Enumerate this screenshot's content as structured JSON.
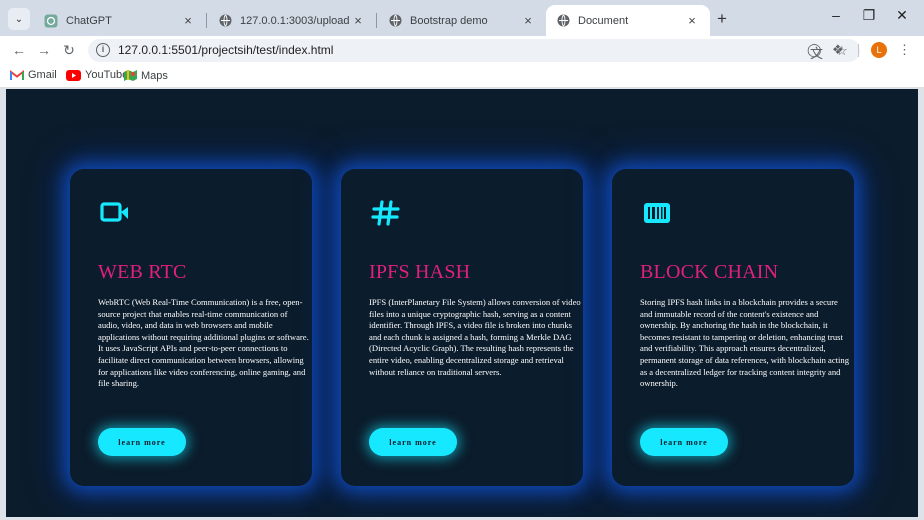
{
  "browser": {
    "tabs": [
      {
        "title": "ChatGPT",
        "active": false,
        "favicon": "chatgpt-icon"
      },
      {
        "title": "127.0.0.1:3003/upload",
        "active": false,
        "favicon": "globe-icon"
      },
      {
        "title": "Bootstrap demo",
        "active": false,
        "favicon": "globe-icon"
      },
      {
        "title": "Document",
        "active": true,
        "favicon": "globe-icon"
      }
    ],
    "new_tab_label": "+",
    "url": "127.0.0.1:5501/projectsih/test/index.html",
    "profile_initial": "L",
    "bookmarks": [
      {
        "label": "Gmail",
        "icon": "gmail-icon"
      },
      {
        "label": "YouTube",
        "icon": "youtube-icon"
      },
      {
        "label": "Maps",
        "icon": "maps-icon"
      }
    ]
  },
  "cards": [
    {
      "icon": "video-camera-icon",
      "title": "WEB RTC",
      "text": "WebRTC (Web Real-Time Communication) is a free, open-source project that enables real-time communication of audio, video, and data in web browsers and mobile applications without requiring additional plugins or software. It uses JavaScript APIs and peer-to-peer connections to facilitate direct communication between browsers, allowing for applications like video conferencing, online gaming, and file sharing.",
      "button": "learn more"
    },
    {
      "icon": "hashtag-icon",
      "title": "IPFS HASH",
      "text": "IPFS (InterPlanetary File System) allows conversion of video files into a unique cryptographic hash, serving as a content identifier. Through IPFS, a video file is broken into chunks and each chunk is assigned a hash, forming a Merkle DAG (Directed Acyclic Graph). The resulting hash represents the entire video, enabling decentralized storage and retrieval without reliance on traditional servers.",
      "button": "learn more"
    },
    {
      "icon": "barcode-icon",
      "title": "BLOCK CHAIN",
      "text": "Storing IPFS hash links in a blockchain provides a secure and immutable record of the content's existence and ownership. By anchoring the hash in the blockchain, it becomes resistant to tampering or deletion, enhancing trust and verifiability. This approach ensures decentralized, permanent storage of data references, with blockchain acting as a decentralized ledger for tracking content integrity and ownership.",
      "button": "learn more"
    }
  ],
  "colors": {
    "page_bg": "#0b1c2c",
    "accent_cyan": "#16e9ff",
    "title_pink": "#e0207f",
    "card_glow": "#1254d2"
  }
}
